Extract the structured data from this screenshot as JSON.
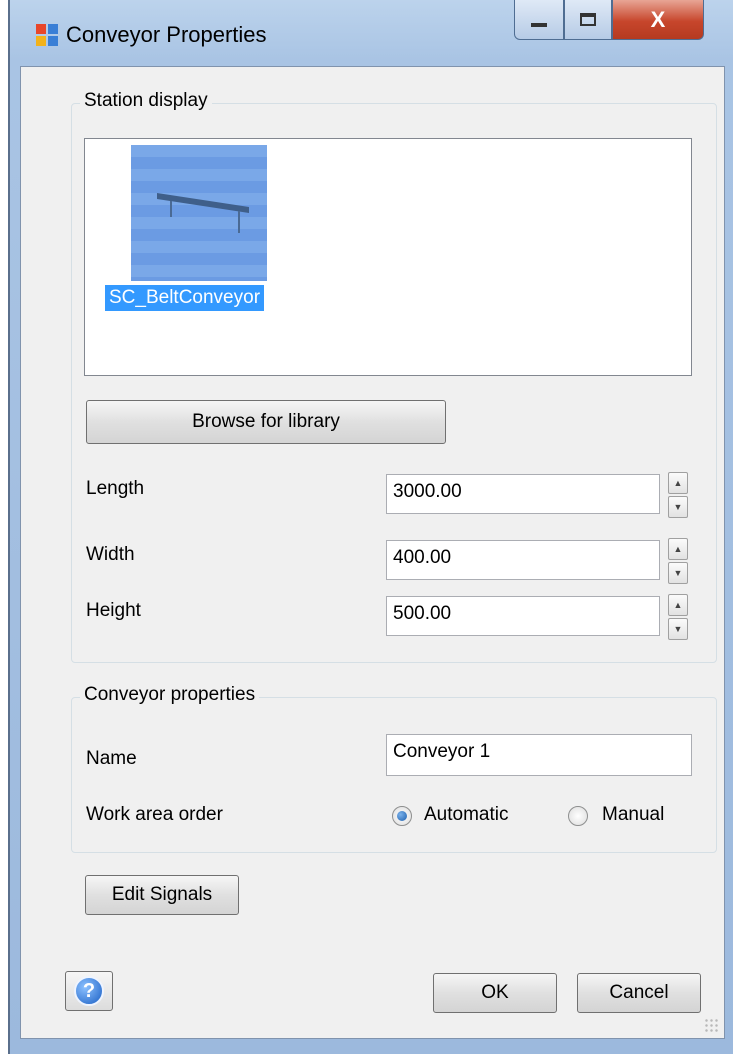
{
  "window": {
    "title": "Conveyor Properties",
    "controls": {
      "minimize": "–",
      "maximize": "□",
      "close": "X"
    }
  },
  "station_display": {
    "legend": "Station display",
    "items": [
      {
        "label": "SC_BeltConveyor",
        "selected": true
      }
    ],
    "browse_label": "Browse for library",
    "fields": [
      {
        "label": "Length",
        "value": "3000.00"
      },
      {
        "label": "Width",
        "value": "400.00"
      },
      {
        "label": "Height",
        "value": "500.00"
      }
    ]
  },
  "conveyor_properties": {
    "legend": "Conveyor properties",
    "name_label": "Name",
    "name_value": "Conveyor 1",
    "order_label": "Work area order",
    "order_options": [
      {
        "label": "Automatic",
        "checked": true
      },
      {
        "label": "Manual",
        "checked": false
      }
    ]
  },
  "buttons": {
    "edit_signals": "Edit Signals",
    "ok": "OK",
    "cancel": "Cancel",
    "help": "?"
  },
  "colors": {
    "selection": "#3399ff",
    "thumbnail": "#7aa8e8"
  }
}
